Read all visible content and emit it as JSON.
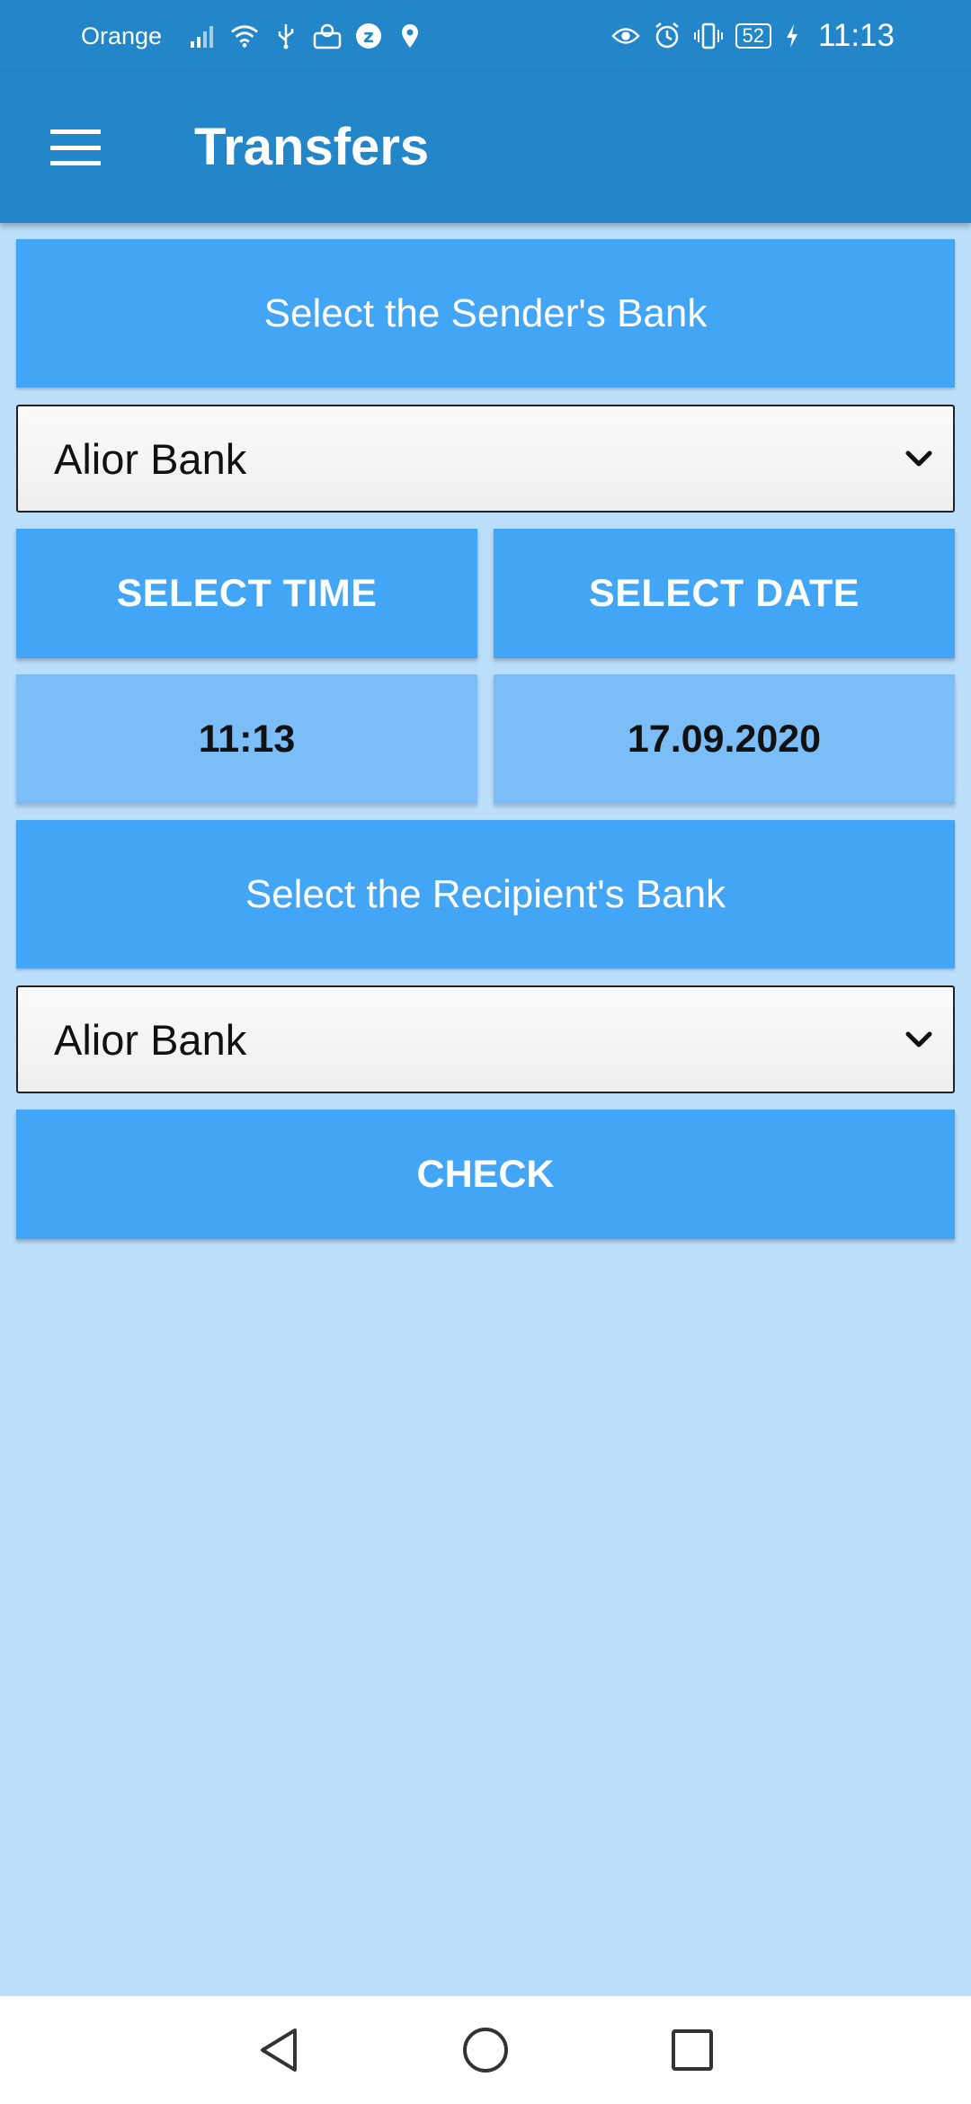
{
  "status_bar": {
    "carrier": "Orange",
    "battery": "52",
    "time": "11:13",
    "icons_left": [
      "signal-icon",
      "wifi-icon",
      "usb-icon",
      "app-icon",
      "z-app-icon",
      "location-icon"
    ],
    "icons_right": [
      "eye-icon",
      "alarm-icon",
      "vibrate-icon",
      "battery-icon",
      "charging-icon"
    ]
  },
  "app_bar": {
    "title": "Transfers",
    "menu_icon": "hamburger-menu-icon"
  },
  "sender": {
    "header": "Select the Sender's Bank",
    "selected_bank": "Alior Bank"
  },
  "datetime": {
    "select_time_label": "SELECT TIME",
    "select_date_label": "SELECT DATE",
    "time_value": "11:13",
    "date_value": "17.09.2020"
  },
  "recipient": {
    "header": "Select the Recipient's Bank",
    "selected_bank": "Alior Bank"
  },
  "actions": {
    "check_label": "CHECK"
  },
  "colors": {
    "primary": "#2286C8",
    "accent": "#42A5F5",
    "value_box": "#7BBDF7",
    "background": "#BBDEFB"
  }
}
